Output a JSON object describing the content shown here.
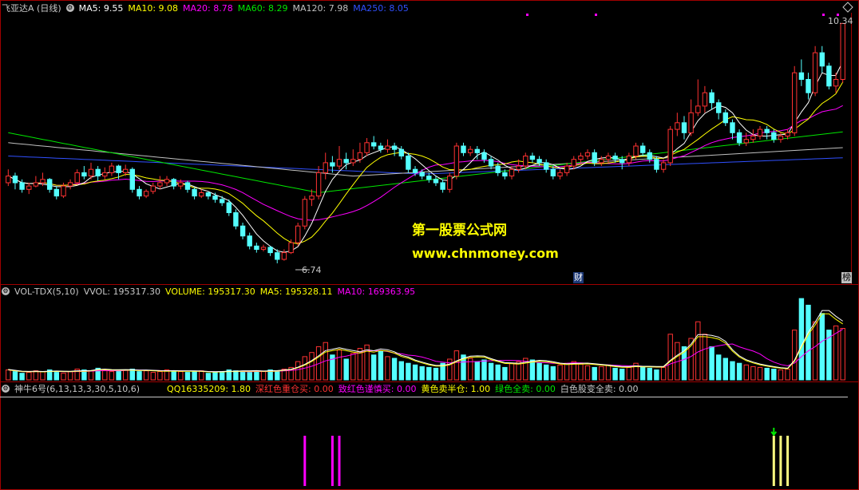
{
  "colors": {
    "up": "#ff3232",
    "down": "#54ffff",
    "ma5": "#ffffff",
    "ma10": "#ffff00",
    "ma20": "#ff00ff",
    "ma60": "#00e600",
    "ma120": "#c0c0c0",
    "ma250": "#3050ff",
    "frame": "#a00000"
  },
  "price_header": {
    "stock": "飞亚达A (日线)",
    "ma5": "MA5: 9.55",
    "ma10": "MA10: 9.08",
    "ma20": "MA20: 8.78",
    "ma60": "MA60: 8.29",
    "ma120": "MA120: 7.98",
    "ma250": "MA250: 8.05"
  },
  "price_labels": {
    "high": "10.34",
    "low": "6.74",
    "cai": "财",
    "bang": "榜"
  },
  "watermark": {
    "line1": "第一股票公式网",
    "line2": "www.chnmoney.com"
  },
  "vol_header": {
    "name": "VOL-TDX(5,10)",
    "vvol": "VVOL: 195317.30",
    "volume": "VOLUME: 195317.30",
    "ma5": "MA5: 195328.11",
    "ma10": "MA10: 169363.95"
  },
  "ind_header": {
    "name": "神牛6号(6,13,13,3,30,5,10,6)",
    "qq": "QQ16335209: 1.80",
    "red": "深红色重仓买: 0.00",
    "magenta": "致红色谨慎买: 0.00",
    "yellow": "黄色卖半仓: 1.00",
    "green": "绿色全卖: 0.00",
    "white": "白色股变全卖: 0.00"
  },
  "chart_data": {
    "type": "candlestick",
    "price_range": [
      6.5,
      10.5
    ],
    "candles": [
      [
        7.95,
        8.05,
        8.15,
        7.9
      ],
      [
        8.05,
        7.95,
        8.1,
        7.85
      ],
      [
        7.95,
        7.85,
        8.0,
        7.8
      ],
      [
        7.85,
        7.9,
        7.95,
        7.78
      ],
      [
        7.9,
        7.95,
        8.05,
        7.88
      ],
      [
        7.95,
        8.0,
        8.1,
        7.9
      ],
      [
        8.0,
        7.85,
        8.02,
        7.8
      ],
      [
        7.85,
        7.75,
        7.9,
        7.7
      ],
      [
        7.75,
        7.9,
        7.95,
        7.72
      ],
      [
        7.9,
        7.95,
        8.0,
        7.85
      ],
      [
        7.95,
        8.1,
        8.15,
        7.92
      ],
      [
        8.1,
        8.05,
        8.2,
        8.0
      ],
      [
        8.05,
        8.15,
        8.25,
        8.0
      ],
      [
        8.15,
        8.05,
        8.2,
        7.98
      ],
      [
        8.05,
        8.1,
        8.18,
        8.0
      ],
      [
        8.1,
        8.2,
        8.25,
        8.05
      ],
      [
        8.2,
        8.1,
        8.22,
        8.0
      ],
      [
        8.1,
        8.15,
        8.22,
        8.05
      ],
      [
        8.15,
        7.85,
        8.18,
        7.8
      ],
      [
        7.85,
        7.75,
        7.9,
        7.7
      ],
      [
        7.75,
        7.82,
        7.85,
        7.72
      ],
      [
        7.82,
        7.9,
        7.95,
        7.78
      ],
      [
        7.9,
        7.95,
        8.05,
        7.85
      ],
      [
        7.95,
        8.0,
        8.05,
        7.9
      ],
      [
        8.0,
        7.9,
        8.02,
        7.85
      ],
      [
        7.9,
        7.95,
        8.0,
        7.85
      ],
      [
        7.95,
        7.85,
        7.98,
        7.8
      ],
      [
        7.85,
        7.75,
        7.88,
        7.7
      ],
      [
        7.75,
        7.8,
        7.85,
        7.72
      ],
      [
        7.8,
        7.75,
        7.82,
        7.7
      ],
      [
        7.75,
        7.7,
        7.8,
        7.65
      ],
      [
        7.7,
        7.65,
        7.75,
        7.6
      ],
      [
        7.65,
        7.5,
        7.7,
        7.45
      ],
      [
        7.5,
        7.3,
        7.55,
        7.25
      ],
      [
        7.3,
        7.15,
        7.35,
        7.1
      ],
      [
        7.15,
        7.0,
        7.2,
        6.95
      ],
      [
        7.0,
        6.95,
        7.05,
        6.9
      ],
      [
        6.95,
        6.98,
        7.02,
        6.92
      ],
      [
        6.98,
        6.9,
        7.0,
        6.85
      ],
      [
        6.9,
        6.8,
        6.95,
        6.74
      ],
      [
        6.8,
        6.9,
        6.95,
        6.78
      ],
      [
        6.9,
        7.05,
        7.1,
        6.88
      ],
      [
        7.05,
        7.3,
        7.35,
        7.0
      ],
      [
        7.3,
        7.7,
        7.75,
        7.25
      ],
      [
        7.7,
        7.75,
        7.85,
        7.6
      ],
      [
        7.75,
        8.1,
        8.2,
        7.7
      ],
      [
        8.1,
        8.25,
        8.4,
        8.0
      ],
      [
        8.25,
        8.2,
        8.35,
        8.1
      ],
      [
        8.2,
        8.3,
        8.5,
        8.15
      ],
      [
        8.3,
        8.25,
        8.4,
        8.15
      ],
      [
        8.25,
        8.3,
        8.45,
        8.2
      ],
      [
        8.3,
        8.4,
        8.55,
        8.25
      ],
      [
        8.4,
        8.55,
        8.62,
        8.35
      ],
      [
        8.55,
        8.5,
        8.65,
        8.45
      ],
      [
        8.5,
        8.45,
        8.55,
        8.4
      ],
      [
        8.45,
        8.5,
        8.6,
        8.4
      ],
      [
        8.5,
        8.45,
        8.55,
        8.35
      ],
      [
        8.45,
        8.35,
        8.5,
        8.3
      ],
      [
        8.35,
        8.15,
        8.4,
        8.1
      ],
      [
        8.15,
        8.1,
        8.2,
        8.05
      ],
      [
        8.1,
        8.05,
        8.15,
        8.0
      ],
      [
        8.05,
        8.0,
        8.1,
        7.95
      ],
      [
        8.0,
        7.95,
        8.05,
        7.9
      ],
      [
        7.95,
        7.85,
        8.0,
        7.8
      ],
      [
        7.85,
        8.05,
        8.1,
        7.8
      ],
      [
        8.05,
        8.5,
        8.55,
        8.0
      ],
      [
        8.5,
        8.4,
        8.55,
        8.35
      ],
      [
        8.4,
        8.45,
        8.5,
        8.35
      ],
      [
        8.45,
        8.4,
        8.5,
        8.3
      ],
      [
        8.4,
        8.3,
        8.45,
        8.25
      ],
      [
        8.3,
        8.2,
        8.35,
        8.15
      ],
      [
        8.2,
        8.1,
        8.25,
        8.05
      ],
      [
        8.1,
        8.05,
        8.15,
        8.0
      ],
      [
        8.05,
        8.15,
        8.2,
        8.0
      ],
      [
        8.15,
        8.2,
        8.3,
        8.1
      ],
      [
        8.2,
        8.35,
        8.4,
        8.15
      ],
      [
        8.35,
        8.3,
        8.4,
        8.25
      ],
      [
        8.3,
        8.25,
        8.35,
        8.2
      ],
      [
        8.25,
        8.15,
        8.3,
        8.1
      ],
      [
        8.15,
        8.05,
        8.2,
        8.0
      ],
      [
        8.05,
        8.1,
        8.15,
        8.0
      ],
      [
        8.1,
        8.2,
        8.25,
        8.05
      ],
      [
        8.2,
        8.3,
        8.35,
        8.15
      ],
      [
        8.3,
        8.35,
        8.4,
        8.25
      ],
      [
        8.35,
        8.4,
        8.45,
        8.3
      ],
      [
        8.4,
        8.25,
        8.45,
        8.2
      ],
      [
        8.25,
        8.3,
        8.35,
        8.2
      ],
      [
        8.3,
        8.35,
        8.4,
        8.25
      ],
      [
        8.35,
        8.3,
        8.4,
        8.25
      ],
      [
        8.3,
        8.25,
        8.35,
        8.15
      ],
      [
        8.25,
        8.35,
        8.4,
        8.2
      ],
      [
        8.35,
        8.5,
        8.55,
        8.3
      ],
      [
        8.5,
        8.4,
        8.55,
        8.35
      ],
      [
        8.4,
        8.3,
        8.45,
        8.25
      ],
      [
        8.3,
        8.15,
        8.35,
        8.1
      ],
      [
        8.15,
        8.25,
        8.3,
        8.1
      ],
      [
        8.25,
        8.75,
        8.8,
        8.2
      ],
      [
        8.75,
        8.85,
        9.0,
        8.65
      ],
      [
        8.85,
        8.7,
        8.95,
        8.6
      ],
      [
        8.7,
        9.0,
        9.2,
        8.65
      ],
      [
        9.0,
        9.1,
        9.5,
        8.95
      ],
      [
        9.1,
        9.3,
        9.4,
        9.0
      ],
      [
        9.3,
        9.15,
        9.35,
        9.05
      ],
      [
        9.15,
        9.0,
        9.2,
        8.9
      ],
      [
        9.0,
        8.85,
        9.05,
        8.8
      ],
      [
        8.85,
        8.7,
        8.9,
        8.6
      ],
      [
        8.7,
        8.55,
        8.75,
        8.5
      ],
      [
        8.55,
        8.6,
        8.7,
        8.5
      ],
      [
        8.6,
        8.65,
        8.75,
        8.55
      ],
      [
        8.65,
        8.75,
        8.8,
        8.6
      ],
      [
        8.75,
        8.7,
        8.8,
        8.6
      ],
      [
        8.7,
        8.6,
        8.75,
        8.55
      ],
      [
        8.6,
        8.65,
        8.7,
        8.55
      ],
      [
        8.65,
        8.7,
        8.75,
        8.6
      ],
      [
        8.7,
        9.6,
        9.7,
        8.65
      ],
      [
        9.6,
        9.5,
        9.8,
        9.4
      ],
      [
        9.5,
        9.3,
        9.6,
        9.2
      ],
      [
        9.3,
        9.9,
        10.0,
        9.25
      ],
      [
        9.9,
        9.7,
        10.0,
        9.6
      ],
      [
        9.7,
        9.4,
        9.75,
        9.35
      ],
      [
        9.4,
        9.5,
        9.6,
        9.3
      ],
      [
        9.5,
        10.34,
        10.34,
        9.45
      ]
    ],
    "volumes": [
      0.12,
      0.1,
      0.08,
      0.09,
      0.11,
      0.1,
      0.12,
      0.09,
      0.08,
      0.1,
      0.13,
      0.12,
      0.11,
      0.14,
      0.12,
      0.1,
      0.11,
      0.12,
      0.13,
      0.1,
      0.11,
      0.09,
      0.1,
      0.12,
      0.11,
      0.1,
      0.09,
      0.1,
      0.11,
      0.08,
      0.09,
      0.1,
      0.12,
      0.11,
      0.1,
      0.09,
      0.11,
      0.1,
      0.12,
      0.11,
      0.13,
      0.15,
      0.22,
      0.28,
      0.33,
      0.4,
      0.45,
      0.3,
      0.36,
      0.25,
      0.32,
      0.38,
      0.42,
      0.3,
      0.35,
      0.28,
      0.26,
      0.22,
      0.2,
      0.18,
      0.16,
      0.15,
      0.14,
      0.2,
      0.25,
      0.35,
      0.3,
      0.26,
      0.22,
      0.24,
      0.2,
      0.18,
      0.15,
      0.2,
      0.22,
      0.26,
      0.24,
      0.2,
      0.18,
      0.16,
      0.18,
      0.2,
      0.22,
      0.19,
      0.17,
      0.15,
      0.16,
      0.18,
      0.14,
      0.13,
      0.15,
      0.2,
      0.16,
      0.14,
      0.12,
      0.15,
      0.55,
      0.45,
      0.4,
      0.5,
      0.7,
      0.55,
      0.4,
      0.3,
      0.26,
      0.22,
      0.2,
      0.18,
      0.16,
      0.15,
      0.14,
      0.13,
      0.12,
      0.13,
      0.6,
      0.98,
      0.9,
      0.7,
      0.8,
      0.6,
      0.65,
      0.62
    ],
    "signals": [
      {
        "i": 43,
        "color": "magenta"
      },
      {
        "i": 47,
        "color": "magenta"
      },
      {
        "i": 48,
        "color": "magenta"
      },
      {
        "i": 111,
        "color": "yellow"
      },
      {
        "i": 112,
        "color": "yellow"
      },
      {
        "i": 113,
        "color": "yellow"
      },
      {
        "i": 126,
        "color": "yellow"
      },
      {
        "i": 127,
        "color": "yellow"
      },
      {
        "i": 128,
        "color": "yellow"
      },
      {
        "i": 129,
        "color": "yellow"
      },
      {
        "i": 130,
        "color": "yellow"
      },
      {
        "i": 131,
        "color": "yellow"
      },
      {
        "i": 132,
        "color": "yellow"
      }
    ],
    "arrow_index": 111
  }
}
